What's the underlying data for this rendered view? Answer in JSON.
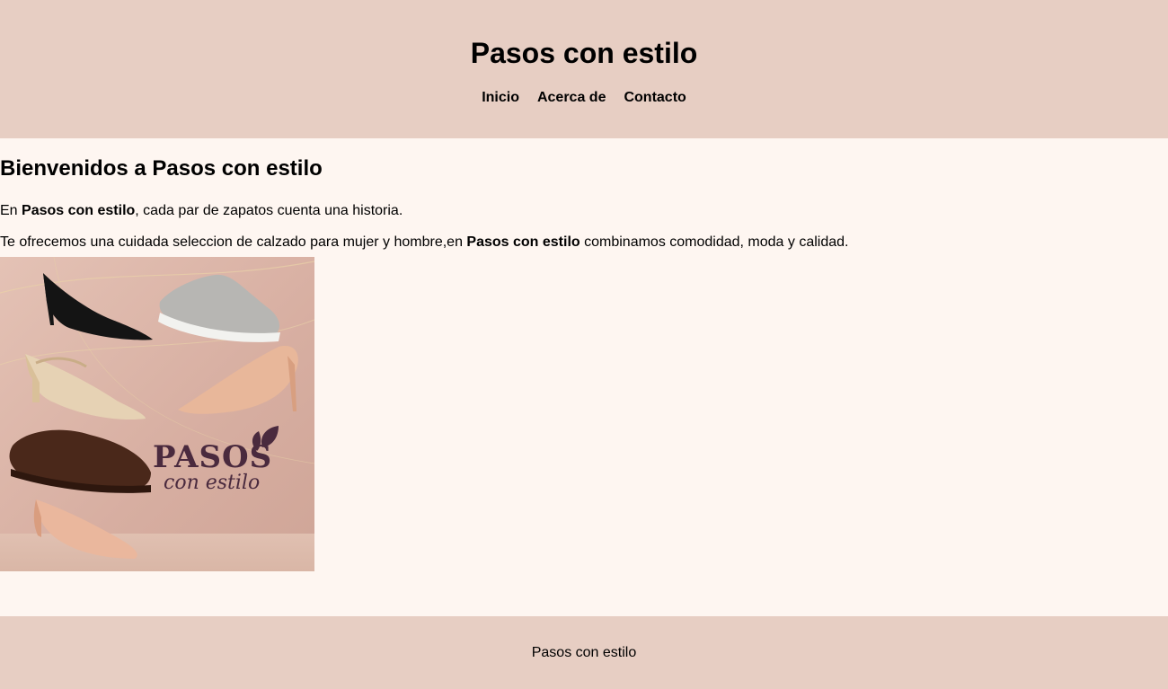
{
  "header": {
    "site_title": "Pasos con estilo",
    "nav": [
      {
        "label": "Inicio"
      },
      {
        "label": "Acerca de"
      },
      {
        "label": "Contacto"
      }
    ]
  },
  "main": {
    "heading": "Bienvenidos a Pasos con estilo",
    "para1": {
      "pre": "En ",
      "brand": "Pasos con estilo",
      "post": ", cada par de zapatos cuenta una historia."
    },
    "para2": {
      "pre": "Te ofrecemos una cuidada seleccion de calzado para mujer y hombre,en ",
      "brand": "Pasos con estilo",
      "post": " combinamos comodidad, moda y calidad."
    },
    "image": {
      "logo_word": "PASOS",
      "logo_sub": "con estilo"
    }
  },
  "footer": {
    "text": "Pasos con estilo"
  },
  "colors": {
    "header_bg": "#e7cec3",
    "page_bg": "#fef6f1",
    "footer_bg": "#e7cec3",
    "logo_color": "#4a2a3e"
  }
}
